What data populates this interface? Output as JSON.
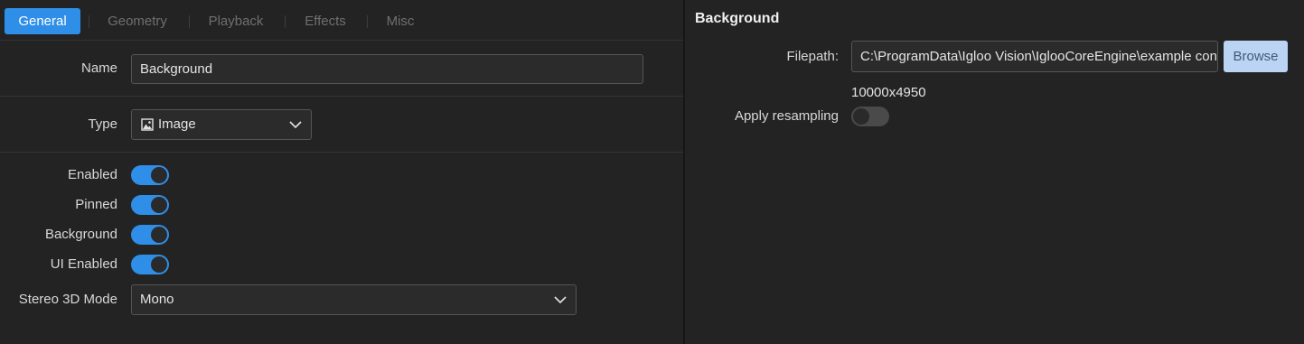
{
  "tabs": [
    {
      "label": "General",
      "active": true
    },
    {
      "label": "Geometry",
      "active": false
    },
    {
      "label": "Playback",
      "active": false
    },
    {
      "label": "Effects",
      "active": false
    },
    {
      "label": "Misc",
      "active": false
    }
  ],
  "general": {
    "name_label": "Name",
    "name_value": "Background",
    "type_label": "Type",
    "type_value": "Image",
    "type_icon": "image-icon",
    "toggles": [
      {
        "label": "Enabled",
        "on": true
      },
      {
        "label": "Pinned",
        "on": true
      },
      {
        "label": "Background",
        "on": true
      },
      {
        "label": "UI Enabled",
        "on": true
      }
    ],
    "stereo_label": "Stereo 3D Mode",
    "stereo_value": "Mono"
  },
  "background_section": {
    "title": "Background",
    "filepath_label": "Filepath:",
    "filepath_value": "C:\\ProgramData\\Igloo Vision\\IglooCoreEngine\\example content\\",
    "browse_label": "Browse",
    "resolution": "10000x4950",
    "resampling_label": "Apply resampling",
    "resampling_on": false
  },
  "colors": {
    "accent": "#2f8fe8",
    "background": "#232323",
    "browse_button": "#bcd4f4"
  }
}
